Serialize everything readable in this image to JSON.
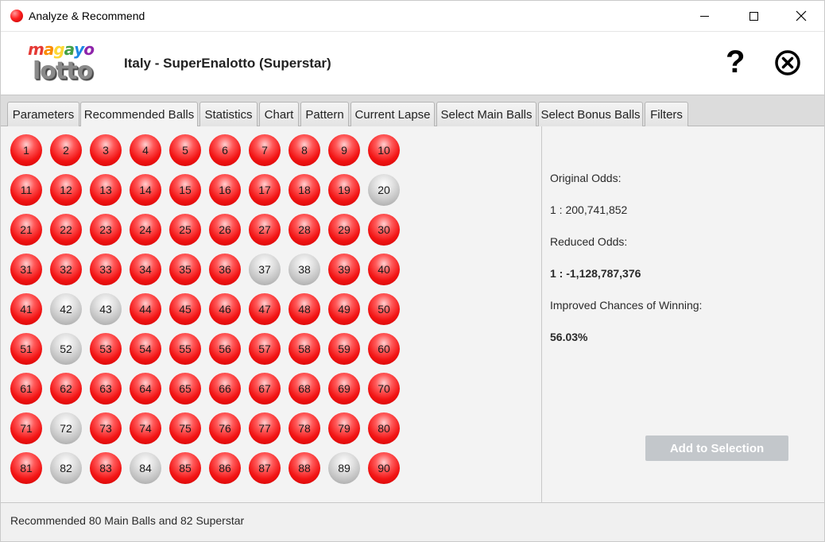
{
  "window": {
    "title": "Analyze & Recommend",
    "icon": "red-ball-icon",
    "controls": [
      "minimize-icon",
      "maximize-icon",
      "close-icon"
    ]
  },
  "header": {
    "logo_top": "magayo",
    "logo_bottom": "lotto",
    "logo_colors": [
      "#e53935",
      "#fb8c00",
      "#fdd835",
      "#43a047",
      "#1e88e5",
      "#8e24aa"
    ],
    "game_title": "Italy - SuperEnalotto (Superstar)",
    "help_glyph": "?",
    "help_icon": "question-mark-icon",
    "exit_icon": "circle-x-icon"
  },
  "tabs": [
    {
      "label": "Parameters",
      "active": false
    },
    {
      "label": "Recommended Balls",
      "active": true
    },
    {
      "label": "Statistics",
      "active": false
    },
    {
      "label": "Chart",
      "active": false
    },
    {
      "label": "Pattern",
      "active": false
    },
    {
      "label": "Current Lapse",
      "active": false
    },
    {
      "label": "Select Main Balls",
      "active": false
    },
    {
      "label": "Select Bonus Balls",
      "active": false
    },
    {
      "label": "Filters",
      "active": false
    }
  ],
  "balls": {
    "numbers": [
      1,
      2,
      3,
      4,
      5,
      6,
      7,
      8,
      9,
      10,
      11,
      12,
      13,
      14,
      15,
      16,
      17,
      18,
      19,
      20,
      21,
      22,
      23,
      24,
      25,
      26,
      27,
      28,
      29,
      30,
      31,
      32,
      33,
      34,
      35,
      36,
      37,
      38,
      39,
      40,
      41,
      42,
      43,
      44,
      45,
      46,
      47,
      48,
      49,
      50,
      51,
      52,
      53,
      54,
      55,
      56,
      57,
      58,
      59,
      60,
      61,
      62,
      63,
      64,
      65,
      66,
      67,
      68,
      69,
      70,
      71,
      72,
      73,
      74,
      75,
      76,
      77,
      78,
      79,
      80,
      81,
      82,
      83,
      84,
      85,
      86,
      87,
      88,
      89,
      90
    ],
    "not_recommended": [
      20,
      37,
      38,
      42,
      43,
      52,
      72,
      82,
      84,
      89
    ],
    "recommended_color": "#f21414",
    "not_recommended_color": "#bdbdbd"
  },
  "info": {
    "original_odds_label": "Original Odds:",
    "original_odds_value": "1 : 200,741,852",
    "reduced_odds_label": "Reduced Odds:",
    "reduced_odds_value": "1 : -1,128,787,376",
    "improved_label": "Improved Chances of Winning:",
    "improved_value": "56.03%"
  },
  "add_button": {
    "label": "Add to Selection",
    "enabled": false
  },
  "status": {
    "text": "Recommended 80 Main Balls and 82 Superstar"
  }
}
